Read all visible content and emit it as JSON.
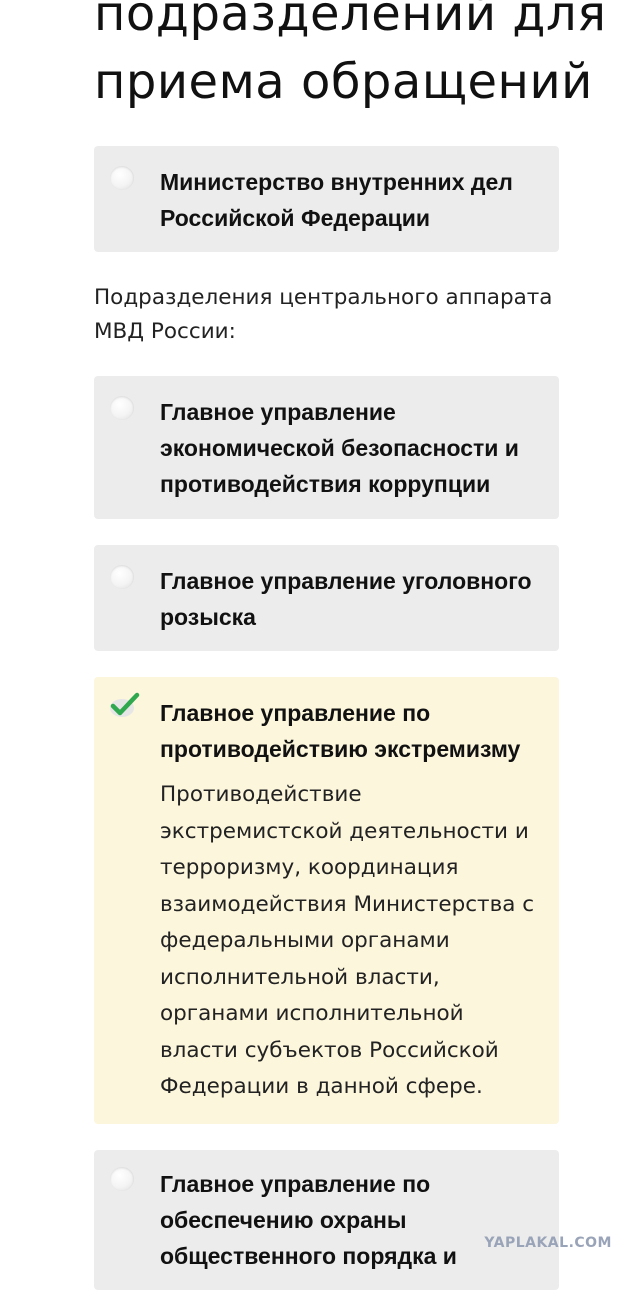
{
  "header": {
    "title": "подразделений для приема обращений"
  },
  "options": [
    {
      "label": "Министерство внутренних дел Российской Федерации",
      "selected": false
    },
    {
      "label": "Главное управление экономической безопасности и противодействия коррупции",
      "selected": false
    },
    {
      "label": "Главное управление уголовного розыска",
      "selected": false
    },
    {
      "label": "Главное управление по противодействию экстремизму",
      "description": "Противодействие экстремистской деятельности и терроризму, координация взаимодействия Министерства с федеральными органами исполнительной власти, органами исполнительной власти субъектов Российской Федерации в данной сфере.",
      "selected": true
    },
    {
      "label": "Главное управление по обеспечению охраны общественного порядка и",
      "selected": false
    }
  ],
  "section": {
    "central_apparatus_label": "Подразделения центрального аппарата МВД России:"
  },
  "watermark": "YAPLAKAL.COM",
  "colors": {
    "card_bg": "#ececec",
    "selected_card_bg": "#fcf6dc",
    "check_green": "#2fa84f"
  }
}
